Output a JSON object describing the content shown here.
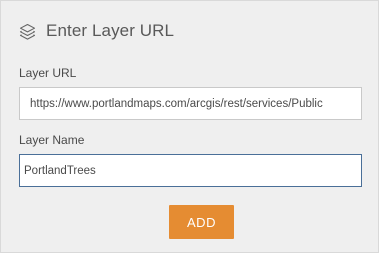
{
  "header": {
    "icon": "layers-icon",
    "title": "Enter Layer URL"
  },
  "form": {
    "url_label": "Layer URL",
    "url_value": "https://www.portlandmaps.com/arcgis/rest/services/Public",
    "name_label": "Layer Name",
    "name_value": "PortlandTrees"
  },
  "actions": {
    "add_label": "ADD"
  },
  "colors": {
    "accent": "#e58c32",
    "focus_border": "#4a6f98",
    "panel_bg": "#efefef"
  }
}
